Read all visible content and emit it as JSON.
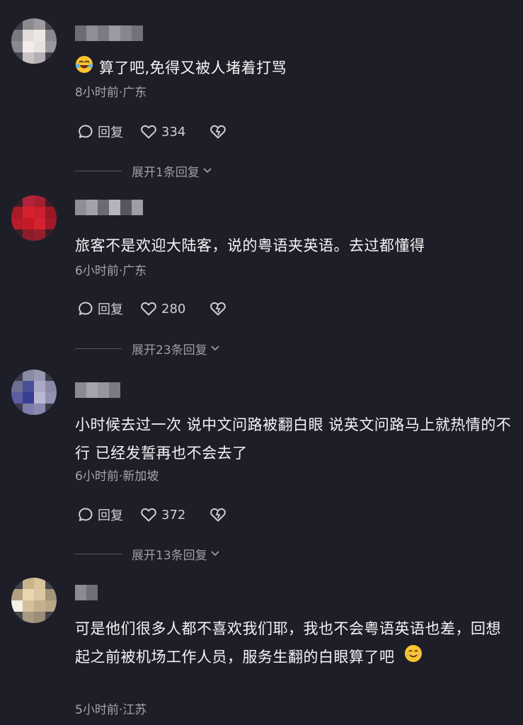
{
  "comments": [
    {
      "text": "算了吧,免得又被人堵着打骂",
      "leading_emoji": "laughing-crying-emoji",
      "meta": "8小时前·广东",
      "reply_label": "回复",
      "likes": "334",
      "expand": "展开1条回复"
    },
    {
      "text": "旅客不是欢迎大陆客，说的粤语夹英语。去过都懂得",
      "meta": "6小时前·广东",
      "reply_label": "回复",
      "likes": "280",
      "expand": "展开23条回复"
    },
    {
      "text": "小时候去过一次 说中文问路被翻白眼 说英文问路马上就热情的不行 已经发誓再也不会去了",
      "meta": "6小时前·新加坡",
      "reply_label": "回复",
      "likes": "372",
      "expand": "展开13条回复"
    },
    {
      "text": "可是他们很多人都不喜欢我们耶，我也不会粤语英语也差，回想起之前被机场工作人员，服务生翻的白眼算了吧",
      "trailing_emoji": "smiling-face-emoji",
      "meta": "5小时前·江苏"
    }
  ],
  "colors": {
    "background": "#1e1e28",
    "text": "#f4f4f6",
    "meta": "#a4a4ae"
  }
}
